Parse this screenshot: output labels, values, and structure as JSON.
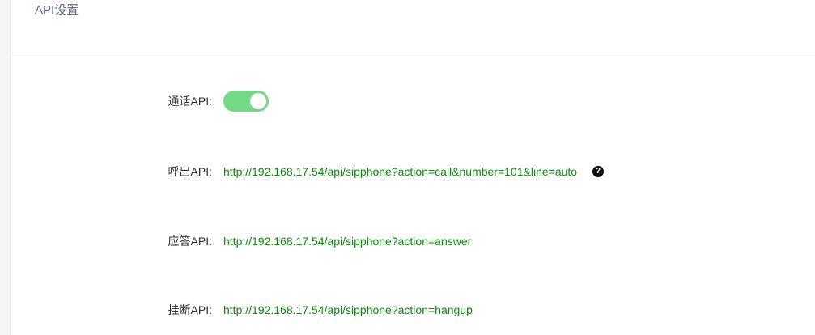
{
  "panel": {
    "title": "API设置"
  },
  "rows": [
    {
      "label": "通话API:",
      "type": "toggle",
      "enabled": true
    },
    {
      "label": "呼出API:",
      "value": "http://192.168.17.54/api/sipphone?action=call&number=101&line=auto",
      "help_icon": "question-circle-icon"
    },
    {
      "label": "应答API:",
      "value": "http://192.168.17.54/api/sipphone?action=answer"
    },
    {
      "label": "挂断API:",
      "value": "http://192.168.17.54/api/sipphone?action=hangup"
    }
  ],
  "colors": {
    "toggle_on": "#72d987",
    "link_green": "#0c8a0c",
    "title": "#5b6b82"
  }
}
